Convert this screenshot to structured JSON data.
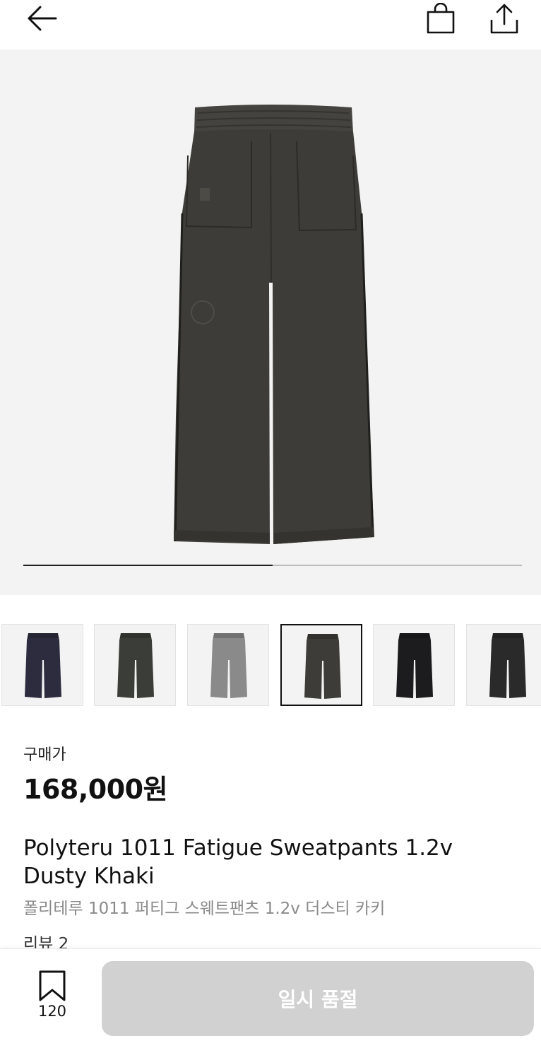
{
  "header": {
    "back_icon": "arrow-left-icon",
    "cart_icon": "shopping-bag-icon",
    "share_icon": "share-icon"
  },
  "gallery": {
    "current_image": 1,
    "image_count": 2,
    "progress_fraction": 0.5,
    "main_color": "#3d3c38",
    "thumbnails": [
      {
        "color": "#2c2c3e",
        "selected": false
      },
      {
        "color": "#3b3d38",
        "selected": false
      },
      {
        "color": "#8a8a8a",
        "selected": false
      },
      {
        "color": "#3d3c38",
        "selected": true
      },
      {
        "color": "#1c1c1e",
        "selected": false
      },
      {
        "color": "#2a2a2a",
        "selected": false
      }
    ]
  },
  "product": {
    "price_label": "구매가",
    "price": "168,000원",
    "name_en": "Polyteru 1011 Fatigue Sweatpants 1.2v Dusty Khaki",
    "name_ko": "폴리테루 1011 퍼티그 스웨트팬츠 1.2v 더스티 카키",
    "reviews": "리뷰 2"
  },
  "bottom_bar": {
    "bookmark_icon": "bookmark-icon",
    "bookmark_count": "120",
    "soldout_label": "일시 품절"
  }
}
